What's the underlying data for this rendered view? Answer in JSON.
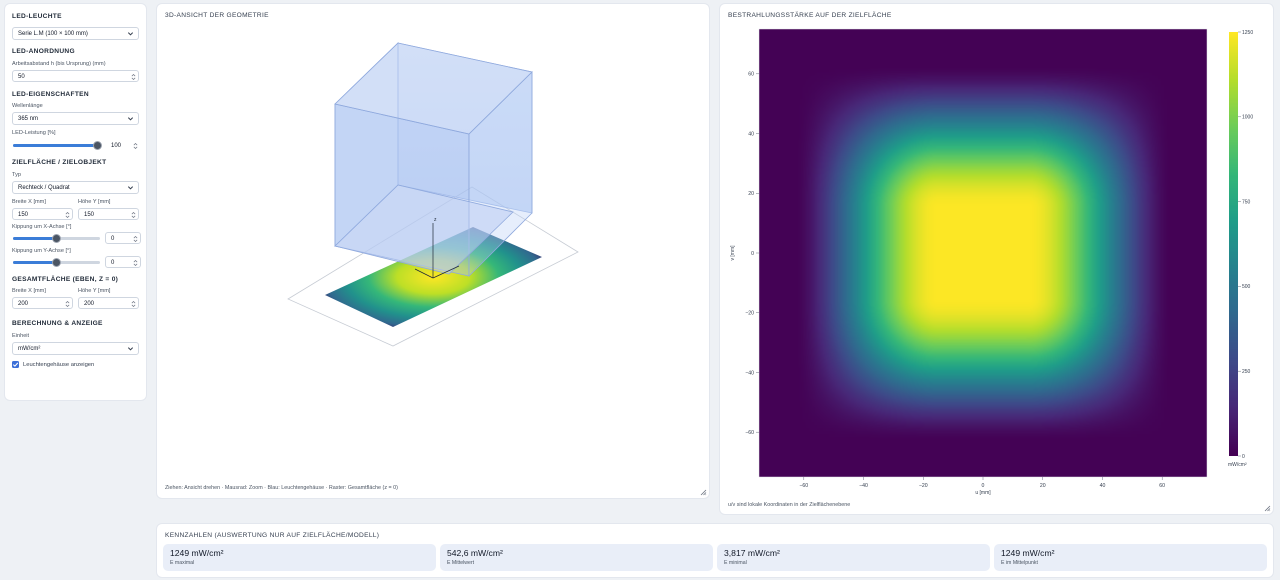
{
  "sidebar": {
    "led": {
      "title": "LED-Leuchte",
      "value": "Serie L.M (100 × 100 mm)"
    },
    "arrangement": {
      "title": "LED-Anordnung",
      "distance_label": "Arbeitsabstand h (bis Ursprung) (mm)",
      "distance_value": "50"
    },
    "props": {
      "title": "LED-Eigenschaften",
      "wavelength_label": "Wellenlänge",
      "wavelength_value": "365 nm",
      "power_label": "LED-Leistung [%]",
      "power_value": "100",
      "power_fraction": 1.0
    },
    "target": {
      "title": "Zielfläche / Zielobjekt",
      "type_label": "Typ",
      "type_value": "Rechteck / Quadrat",
      "width_label": "Breite X [mm]",
      "width_value": "150",
      "height_label": "Höhe Y [mm]",
      "height_value": "150",
      "tilt_x_label": "Kippung um X-Achse [°]",
      "tilt_x_value": "0",
      "tilt_x_fraction": 0.5,
      "tilt_y_label": "Kippung um Y-Achse [°]",
      "tilt_y_value": "0",
      "tilt_y_fraction": 0.5
    },
    "total": {
      "title": "Gesamtfläche (eben, z = 0)",
      "width_label": "Breite X [mm]",
      "width_value": "200",
      "height_label": "Höhe Y [mm]",
      "height_value": "200"
    },
    "calc": {
      "title": "Berechnung & Anzeige",
      "unit_label": "Einheit",
      "unit_value": "mW/cm²",
      "housing_label": "Leuchtengehäuse anzeigen",
      "housing_checked": true
    }
  },
  "view3d": {
    "title": "3D-Ansicht der Geometrie",
    "axis_z": "z",
    "hint": "Ziehen: Ansicht drehen · Mausrad: Zoom · Blau: Leuchtengehäuse · Raster: Gesamtfläche (z = 0)"
  },
  "heatmap": {
    "title": "Bestrahlungsstärke auf der Zielfläche",
    "footnote": "u/v sind lokale Koordinaten in der Zielflächenebene",
    "colorbar_unit": "mW/cm²"
  },
  "chart_data": {
    "type": "heatmap",
    "xlabel": "u [mm]",
    "ylabel": "v [mm]",
    "xlim": [
      -75,
      75
    ],
    "ylim": [
      -75,
      75
    ],
    "x_ticks": [
      "−60",
      "−40",
      "−20",
      "0",
      "20",
      "40",
      "60"
    ],
    "x_tick_values": [
      -60,
      -40,
      -20,
      0,
      20,
      40,
      60
    ],
    "y_ticks": [
      "60",
      "40",
      "20",
      "0",
      "−20",
      "−40",
      "−60"
    ],
    "y_tick_values": [
      60,
      40,
      20,
      0,
      -20,
      -40,
      -60
    ],
    "colorbar": {
      "min": 0,
      "max": 1250,
      "ticks": [
        0,
        250,
        500,
        750,
        1000,
        1250
      ],
      "unit": "mW/cm²"
    },
    "colormap": "viridis",
    "max_value": 1249,
    "min_value": 3.817,
    "center_value": 1249,
    "plateau_halfwidth_mm": 33,
    "falloff_mm": 30
  },
  "metrics": {
    "title": "Kennzahlen (Auswertung nur auf Zielfläche/Modell)",
    "cards": [
      {
        "value": "1249 mW/cm²",
        "label": "E maximal"
      },
      {
        "value": "542,6 mW/cm²",
        "label": "E Mittelwert"
      },
      {
        "value": "3,817 mW/cm²",
        "label": "E minimal"
      },
      {
        "value": "1249 mW/cm²",
        "label": "E im Mittelpunkt"
      }
    ]
  },
  "colors": {
    "accent": "#3b7dd8",
    "panel": "#ffffff",
    "background": "#eef1f5",
    "card": "#e9eef8"
  },
  "icons": {
    "select": "chevron-down-icon",
    "stepper": "spin-arrows-icon",
    "check": "checkmark-icon",
    "resize": "resize-handle-icon"
  }
}
